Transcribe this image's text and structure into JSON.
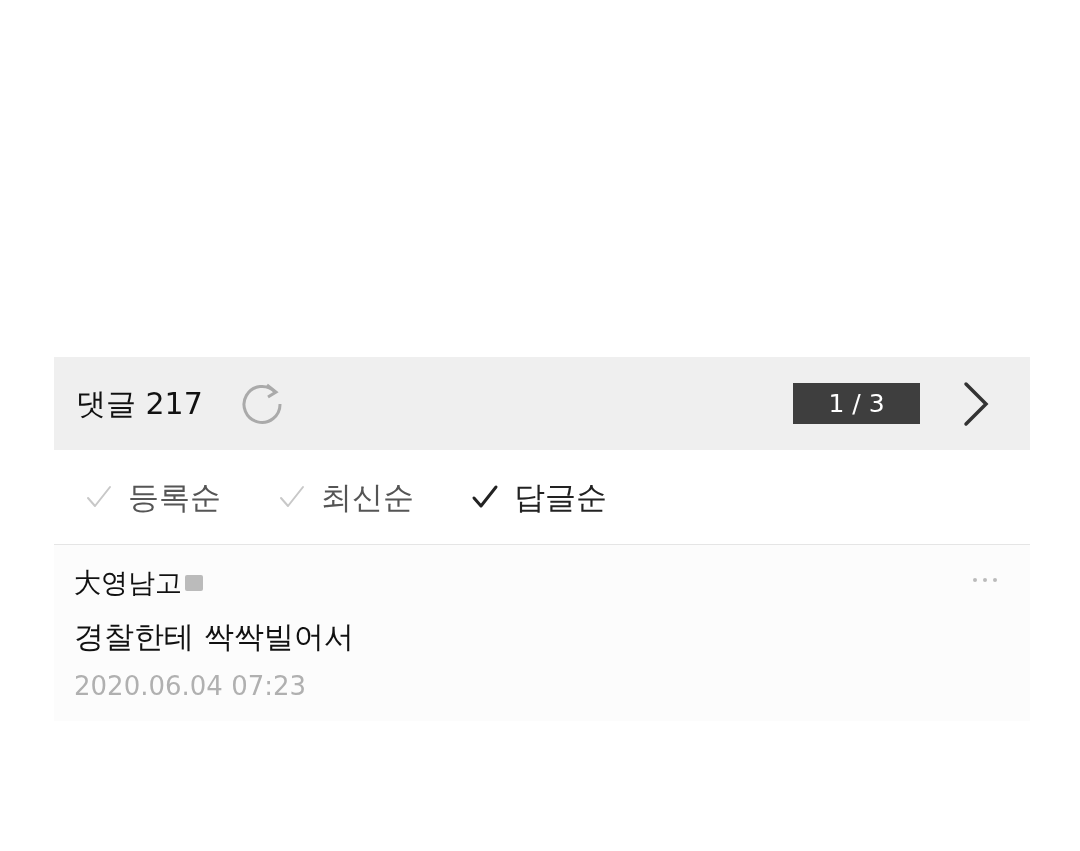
{
  "header": {
    "title": "댓글 217",
    "page": "1 / 3"
  },
  "sort_options": [
    {
      "label": "등록순",
      "selected": false
    },
    {
      "label": "최신순",
      "selected": false
    },
    {
      "label": "답글순",
      "selected": true
    }
  ],
  "comments": [
    {
      "author": "大영남고",
      "text": "경찰한테 싹싹빌어서",
      "date": "2020.06.04 07:23"
    }
  ]
}
